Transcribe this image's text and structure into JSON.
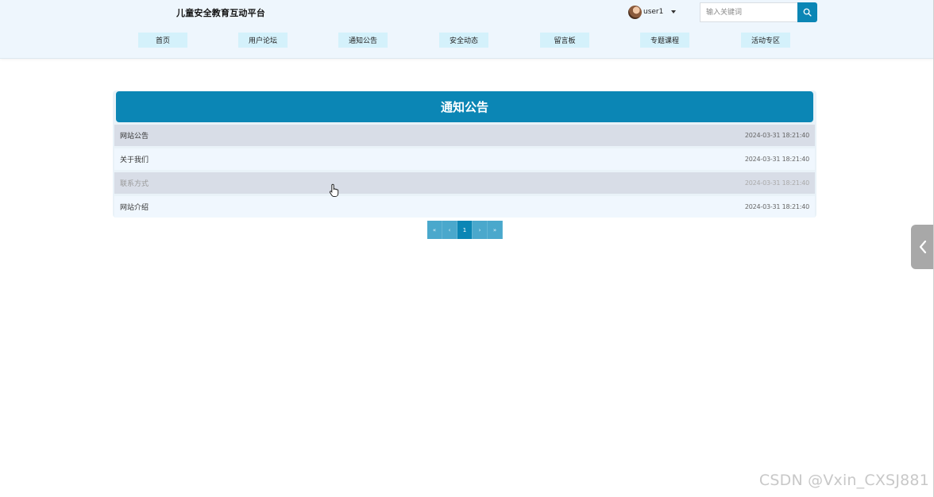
{
  "header": {
    "site_title": "儿童安全教育互动平台",
    "user": {
      "name": "user1"
    },
    "search": {
      "placeholder": "输入关键词"
    },
    "nav": [
      {
        "label": "首页"
      },
      {
        "label": "用户论坛"
      },
      {
        "label": "通知公告"
      },
      {
        "label": "安全动态"
      },
      {
        "label": "留言板"
      },
      {
        "label": "专题课程"
      },
      {
        "label": "活动专区"
      }
    ]
  },
  "main": {
    "panel_title": "通知公告",
    "items": [
      {
        "title": "网站公告",
        "date": "2024-03-31 18:21:40"
      },
      {
        "title": "关于我们",
        "date": "2024-03-31 18:21:40"
      },
      {
        "title": "联系方式",
        "date": "2024-03-31 18:21:40"
      },
      {
        "title": "网站介绍",
        "date": "2024-03-31 18:21:40"
      }
    ],
    "pagination": {
      "first": "«",
      "prev": "‹",
      "current": "1",
      "next": "›",
      "last": "»"
    }
  },
  "watermark": "CSDN @Vxin_CXSJ881",
  "colors": {
    "accent": "#0b86b5",
    "header_bg": "#eef6fd",
    "nav_item_bg": "#d4f1fb",
    "row_dark": "#d8dde7",
    "row_light": "#f0f7fe"
  },
  "icons": {
    "search": "search-icon",
    "dropdown": "caret-down-icon",
    "side_toggle": "chevron-left-icon",
    "pointer": "hand-pointer-icon"
  }
}
